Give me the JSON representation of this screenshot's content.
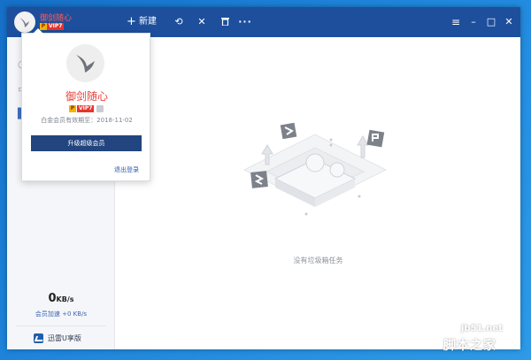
{
  "window": {
    "username": "御剑随心",
    "badge_p": "P",
    "badge_vip": "VIP7"
  },
  "toolbar": {
    "new_label": "新建",
    "new_icon": "plus-icon",
    "undo_icon": "undo-icon",
    "close_icon": "close-icon",
    "trash_icon": "trash-icon",
    "more_icon": "more-icon"
  },
  "window_controls": {
    "menu_icon": "hamburger-icon",
    "minimize_icon": "minimize-icon",
    "maximize_icon": "maximize-icon",
    "close_icon": "window-close-icon"
  },
  "sidebar": {
    "speed_value": "0",
    "speed_unit": "KB/s",
    "accel_text": "会员加速 +0 KB/s",
    "uplus_label": "迅雷U享版"
  },
  "popup": {
    "name": "御剑随心",
    "badge_p": "P",
    "badge_vip": "VIP7",
    "expire_text": "白金会员有效期至：2018-11-02",
    "upgrade_label": "升级超级会员",
    "logout_label": "退出登录"
  },
  "main": {
    "empty_text": "没有垃圾箱任务"
  },
  "watermark": {
    "url": "jb51.net",
    "text": "脚本之家"
  },
  "colors": {
    "titlebar": "#1d4f9c",
    "accent_red": "#e8423a",
    "upgrade_button": "#22447f",
    "link_blue": "#2c5aa8"
  }
}
